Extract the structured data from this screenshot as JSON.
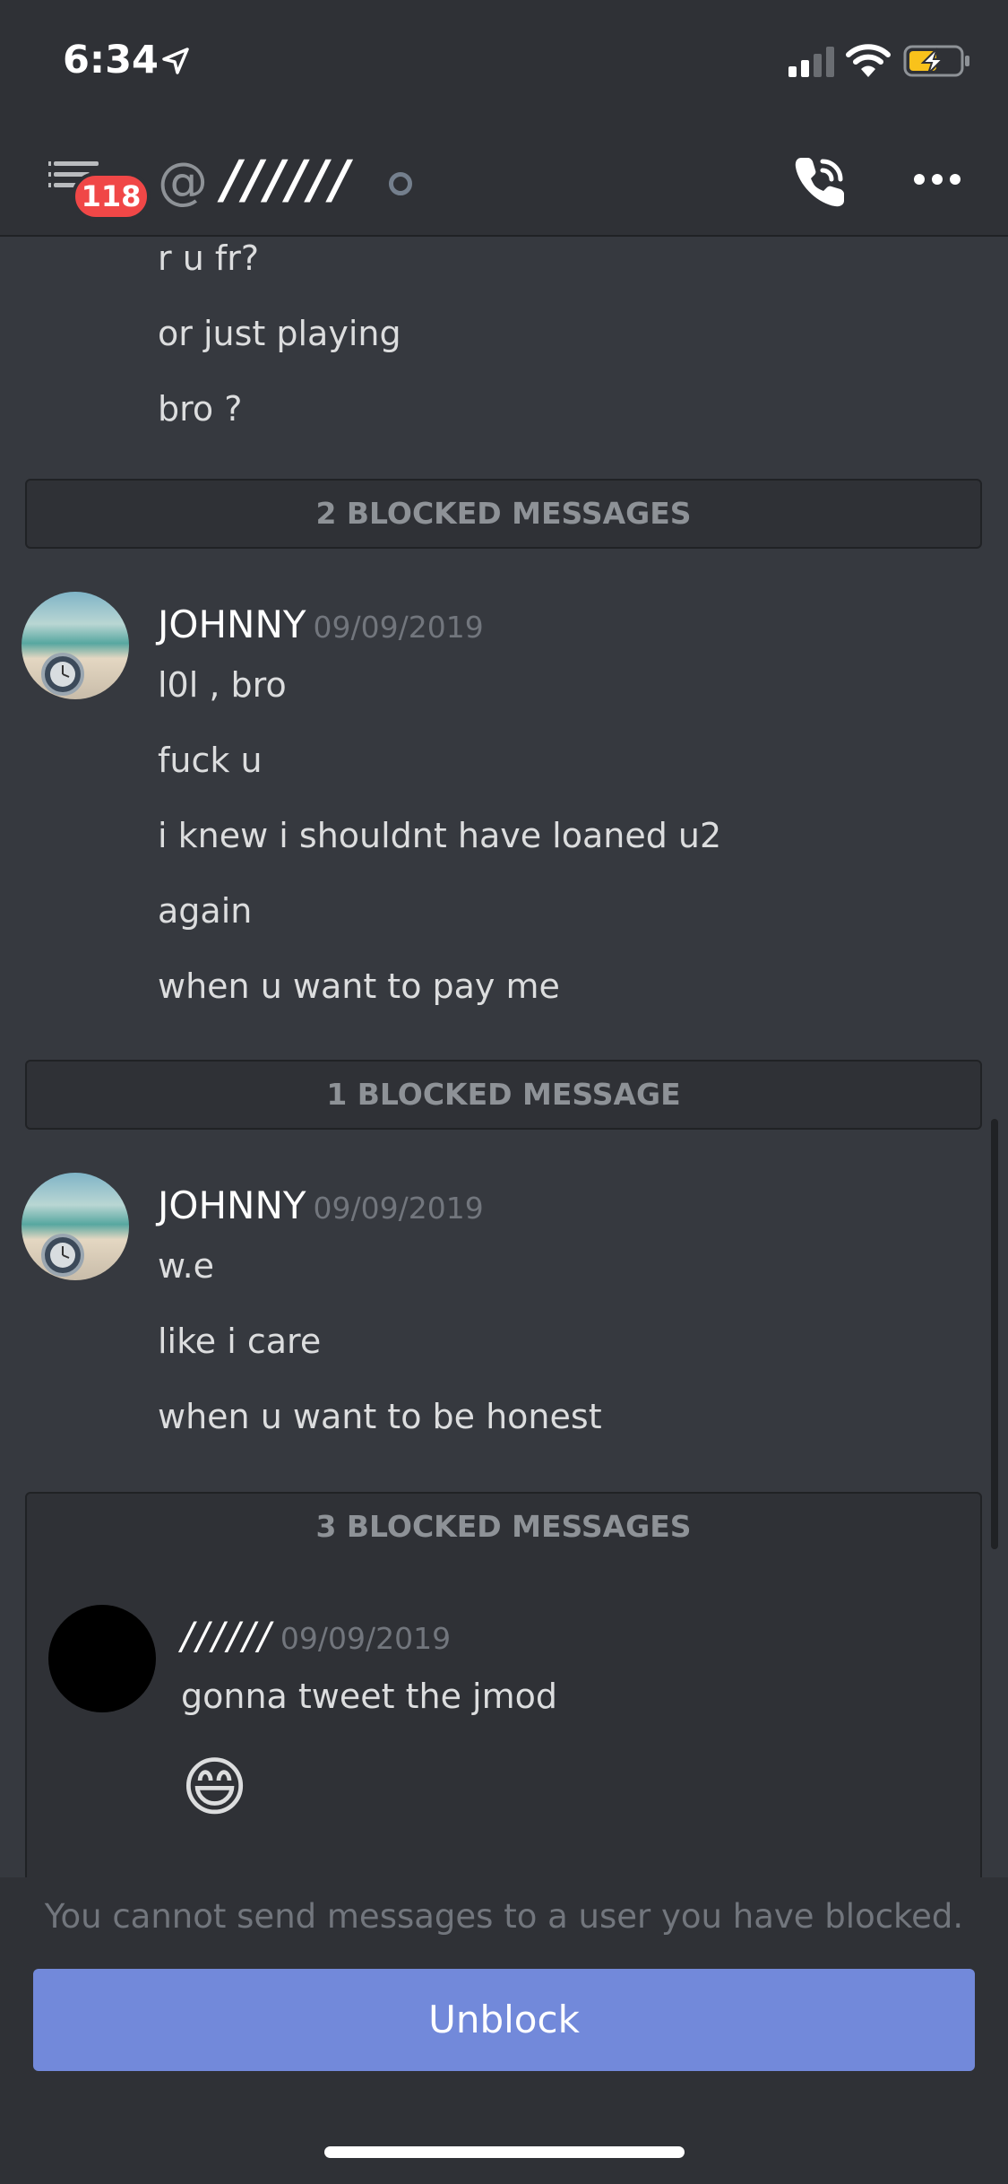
{
  "status_bar": {
    "time": "6:34"
  },
  "header": {
    "unread_count": "118",
    "at_symbol": "@",
    "channel_name": "//////"
  },
  "messages_top": [
    "r u fr?",
    "or just playing",
    "bro ?"
  ],
  "blocked_groups": [
    {
      "label": "2 BLOCKED MESSAGES"
    },
    {
      "label": "1 BLOCKED MESSAGE"
    },
    {
      "label": "3 BLOCKED MESSAGES"
    }
  ],
  "message_groups": [
    {
      "author": "JOHNNY",
      "timestamp": "09/09/2019",
      "lines": [
        "l0l , bro",
        "fuck u",
        "i knew i shouldnt have loaned u2",
        "again",
        "when u want to pay me"
      ]
    },
    {
      "author": "JOHNNY",
      "timestamp": "09/09/2019",
      "lines": [
        "w.e",
        "like i care",
        "when u want to be honest"
      ]
    }
  ],
  "blocked_message": {
    "author": "//////",
    "timestamp": "09/09/2019",
    "text": "gonna tweet the jmod",
    "emoji": "😄"
  },
  "footer": {
    "notice": "You cannot send messages to a user you have blocked.",
    "unblock_label": "Unblock"
  },
  "colors": {
    "accent": "#7289da",
    "badge": "#f04747",
    "background": "#36393f",
    "panel": "#2f3136"
  }
}
